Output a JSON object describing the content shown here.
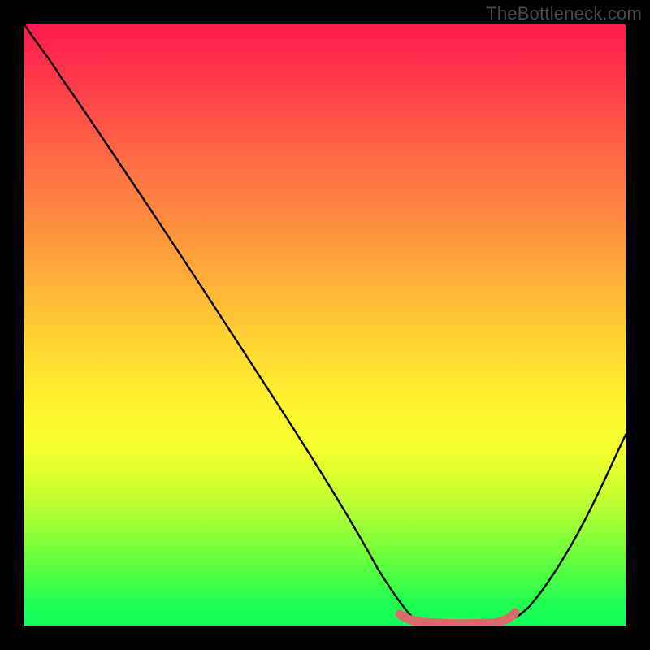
{
  "watermark": "TheBottleneck.com",
  "chart_data": {
    "type": "line",
    "title": "",
    "xlabel": "",
    "ylabel": "",
    "xlim": [
      0,
      100
    ],
    "ylim": [
      0,
      100
    ],
    "series": [
      {
        "name": "bottleneck-curve",
        "x": [
          0,
          4,
          8,
          12,
          18,
          24,
          30,
          36,
          42,
          48,
          54,
          58,
          60,
          63,
          66,
          70,
          74,
          78,
          80,
          84,
          88,
          92,
          96,
          100
        ],
        "y": [
          100,
          96,
          92,
          87,
          79,
          70,
          62,
          53,
          44,
          35,
          26,
          18,
          12,
          6,
          2,
          0,
          0,
          0,
          1,
          4,
          10,
          18,
          27,
          38
        ]
      },
      {
        "name": "optimal-band",
        "x": [
          62,
          66,
          70,
          74,
          78,
          80
        ],
        "y": [
          1.2,
          0.6,
          0.5,
          0.5,
          0.7,
          1.5
        ]
      }
    ],
    "colors": {
      "curve": "#000000",
      "band": "#d96a6a",
      "gradient_top": "#ff1a4d",
      "gradient_bottom": "#0eff5d"
    }
  }
}
